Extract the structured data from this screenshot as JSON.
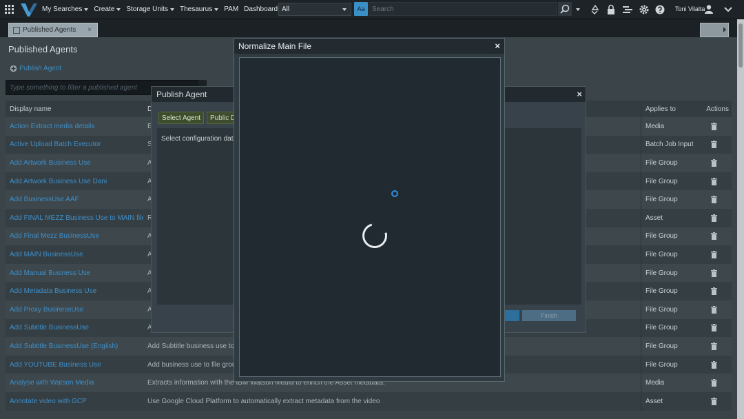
{
  "topbar": {
    "menu": [
      {
        "label": "My Searches",
        "dropdown": true
      },
      {
        "label": "Create",
        "dropdown": true
      },
      {
        "label": "Storage Units",
        "dropdown": true
      },
      {
        "label": "Thesaurus",
        "dropdown": true
      },
      {
        "label": "PAM",
        "dropdown": false
      },
      {
        "label": "Dashboards",
        "dropdown": true
      }
    ],
    "scope_value": "All",
    "aa_label": "Aa",
    "search_placeholder": "Search",
    "user_name": "Toni Vilalta"
  },
  "tabs": [
    {
      "label": "Published Agents",
      "close": "×"
    }
  ],
  "page": {
    "title": "Published Agents",
    "publish_link": "Publish Agent",
    "filter_placeholder": "Type something to filter a published agent"
  },
  "table": {
    "headers": {
      "name": "Display name",
      "description": "D",
      "applies": "Applies to",
      "actions": "Actions"
    },
    "rows": [
      {
        "name": "Action Extract media details",
        "description": "E",
        "applies": "Media"
      },
      {
        "name": "Active Upload Batch Executor",
        "description": "S",
        "applies": "Batch Job Input"
      },
      {
        "name": "Add Artwork Business Use",
        "description": "A",
        "applies": "File Group"
      },
      {
        "name": "Add Artwork Business Use Dani",
        "description": "A",
        "applies": "File Group"
      },
      {
        "name": "Add BusinessUse AAF",
        "description": "A",
        "applies": "File Group"
      },
      {
        "name": "Add FINAL MEZZ Business Use to MAIN file",
        "description": "R",
        "applies": "Asset"
      },
      {
        "name": "Add Final Mezz BusinessUse",
        "description": "A",
        "applies": "File Group"
      },
      {
        "name": "Add MAIN BusinessUse",
        "description": "A",
        "applies": "File Group"
      },
      {
        "name": "Add Manual Business Use",
        "description": "A",
        "applies": "File Group"
      },
      {
        "name": "Add Metadata Business Use",
        "description": "A",
        "applies": "File Group"
      },
      {
        "name": "Add Proxy BusinessUse",
        "description": "A",
        "applies": "File Group"
      },
      {
        "name": "Add Subtitle BusinessUse",
        "description": "A",
        "applies": "File Group"
      },
      {
        "name": "Add Subtitle BusinessUse (English)",
        "description": "Add Subtitle business use to fi",
        "applies": "File Group"
      },
      {
        "name": "Add YOUTUBE Business Use",
        "description": "Add business use to file group",
        "applies": "File Group"
      },
      {
        "name": "Analyse with Watson Media",
        "description": "Extracts information with the IBM Watson Media to enrich the Asset metadata.",
        "applies": "Media"
      },
      {
        "name": "Annotate video with GCP",
        "description": "Use Google Cloud Platform to automatically extract metadata from the video",
        "applies": "Asset"
      }
    ]
  },
  "publish_dialog": {
    "title": "Publish Agent",
    "close": "×",
    "tab_select": "Select Agent",
    "tab_public": "Public D",
    "body_text": "Select configuration data",
    "finish_label": "Finish"
  },
  "normalize_dialog": {
    "title": "Normalize Main File",
    "close": "×"
  },
  "colors": {
    "accent": "#3a8fc7",
    "link": "#3e8fc9",
    "spinner": "#2f8fe0"
  }
}
